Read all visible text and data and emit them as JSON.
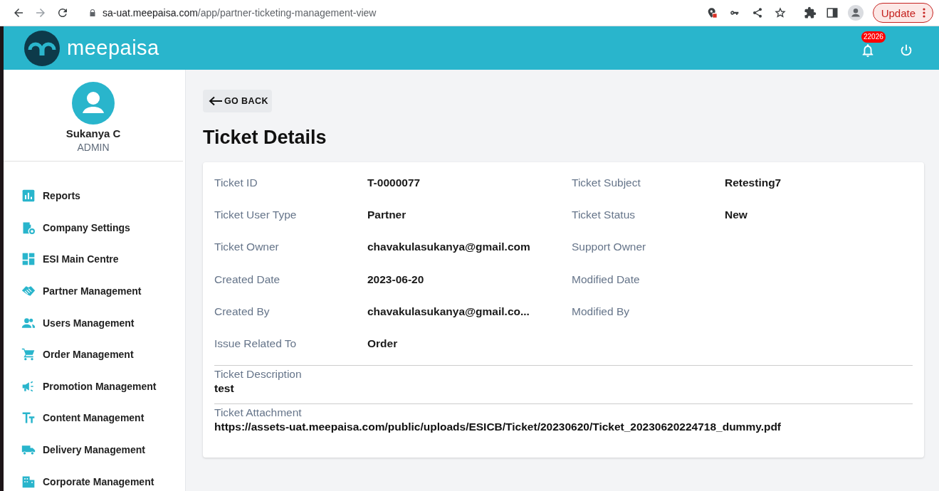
{
  "browser": {
    "url_host": "sa-uat.meepaisa.com",
    "url_path": "/app/partner-ticketing-management-view",
    "update_button": "Update"
  },
  "header": {
    "brand": "meepaisa",
    "notification_count": "22026"
  },
  "user": {
    "name": "Sukanya C",
    "role": "ADMIN"
  },
  "sidebar": {
    "items": [
      {
        "label": "Reports"
      },
      {
        "label": "Company Settings"
      },
      {
        "label": "ESI Main Centre"
      },
      {
        "label": "Partner Management"
      },
      {
        "label": "Users Management"
      },
      {
        "label": "Order Management"
      },
      {
        "label": "Promotion Management"
      },
      {
        "label": "Content Management"
      },
      {
        "label": "Delivery Management"
      },
      {
        "label": "Corporate Management"
      }
    ]
  },
  "page": {
    "back_button": "GO BACK",
    "title": "Ticket Details"
  },
  "details": [
    {
      "label": "Ticket ID",
      "value": "T-0000077"
    },
    {
      "label": "Ticket Subject",
      "value": "Retesting7"
    },
    {
      "label": "Ticket User Type",
      "value": "Partner"
    },
    {
      "label": "Ticket Status",
      "value": "New"
    },
    {
      "label": "Ticket Owner",
      "value": "chavakulasukanya@gmail.com"
    },
    {
      "label": "Support Owner"
    },
    {
      "label": "Created Date",
      "value": "2023-06-20"
    },
    {
      "label": "Modified Date"
    },
    {
      "label": "Created By",
      "value": "chavakulasukanya@gmail.co..."
    },
    {
      "label": "Modified By"
    },
    {
      "label": "Issue Related To",
      "value": "Order"
    }
  ],
  "sections": [
    {
      "label": "Ticket Description",
      "value": "test"
    },
    {
      "label": "Ticket Attachment",
      "value": "https://assets-uat.meepaisa.com/public/uploads/ESICB/Ticket/20230620/Ticket_20230620224718_dummy.pdf"
    }
  ]
}
